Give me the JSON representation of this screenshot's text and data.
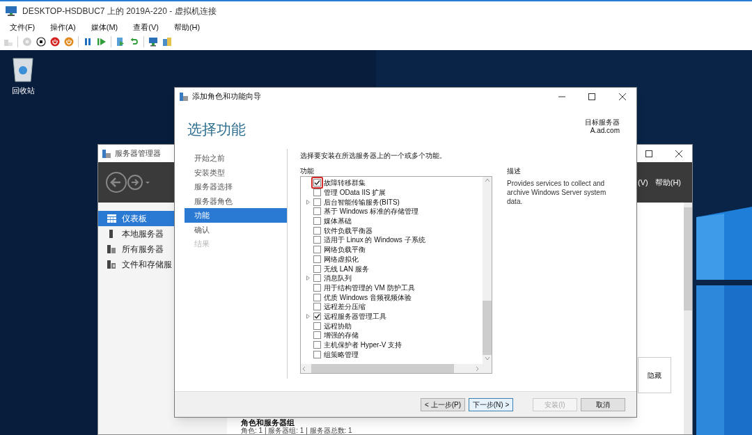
{
  "host_window": {
    "title": "DESKTOP-HSDBUC7 上的 2019A-220 - 虚拟机连接",
    "menu": [
      "文件(F)",
      "操作(A)",
      "媒体(M)",
      "查看(V)",
      "帮助(H)"
    ],
    "toolbar": [
      {
        "kind": "box",
        "disabled": true
      },
      {
        "kind": "sep"
      },
      {
        "kind": "disc",
        "disabled": true
      },
      {
        "kind": "stop",
        "disabled": false
      },
      {
        "kind": "power",
        "disabled": false
      },
      {
        "kind": "reset",
        "disabled": false
      },
      {
        "kind": "sep"
      },
      {
        "kind": "pause",
        "disabled": false
      },
      {
        "kind": "play",
        "disabled": false
      },
      {
        "kind": "sep"
      },
      {
        "kind": "document",
        "disabled": false
      },
      {
        "kind": "undo",
        "disabled": false
      },
      {
        "kind": "sep"
      },
      {
        "kind": "monitor",
        "disabled": false
      },
      {
        "kind": "files",
        "disabled": false
      }
    ]
  },
  "desktop": {
    "icons": [
      {
        "label": "回收站"
      }
    ]
  },
  "server_manager": {
    "title": "服务器管理器",
    "menu": [
      "(V)",
      "帮助(H)"
    ],
    "sidebar": [
      {
        "label": "仪表板",
        "kind": "dashboard",
        "selected": true
      },
      {
        "label": "本地服务器",
        "kind": "server",
        "selected": false
      },
      {
        "label": "所有服务器",
        "kind": "servers",
        "selected": false
      },
      {
        "label": "文件和存储服",
        "kind": "storage",
        "selected": false
      }
    ],
    "hide_button": "隐藏",
    "section_title": "角色和服务器组",
    "section_summary": "角色: 1 | 服务器组: 1 | 服务器总数: 1"
  },
  "wizard": {
    "title": "添加角色和功能向导",
    "heading": "选择功能",
    "target_label": "目标服务器",
    "target_server": "A.ad.com",
    "steps": [
      {
        "label": "开始之前",
        "selected": false,
        "disabled": false
      },
      {
        "label": "安装类型",
        "selected": false,
        "disabled": false
      },
      {
        "label": "服务器选择",
        "selected": false,
        "disabled": false
      },
      {
        "label": "服务器角色",
        "selected": false,
        "disabled": false
      },
      {
        "label": "功能",
        "selected": true,
        "disabled": false
      },
      {
        "label": "确认",
        "selected": false,
        "disabled": false
      },
      {
        "label": "结果",
        "selected": false,
        "disabled": true
      }
    ],
    "instruction": "选择要安装在所选服务器上的一个或多个功能。",
    "features_label": "功能",
    "features": [
      {
        "label": "故障转移群集",
        "checked": true,
        "expandable": false,
        "highlighted": true
      },
      {
        "label": "管理 OData IIS 扩展",
        "checked": false,
        "expandable": false,
        "highlighted": false
      },
      {
        "label": "后台智能传输服务(BITS)",
        "checked": false,
        "expandable": true,
        "highlighted": false
      },
      {
        "label": "基于 Windows 标准的存储管理",
        "checked": false,
        "expandable": false,
        "highlighted": false
      },
      {
        "label": "媒体基础",
        "checked": false,
        "expandable": false,
        "highlighted": false
      },
      {
        "label": "软件负载平衡器",
        "checked": false,
        "expandable": false,
        "highlighted": false
      },
      {
        "label": "适用于 Linux 的 Windows 子系统",
        "checked": false,
        "expandable": false,
        "highlighted": false
      },
      {
        "label": "网络负载平衡",
        "checked": false,
        "expandable": false,
        "highlighted": false
      },
      {
        "label": "网络虚拟化",
        "checked": false,
        "expandable": false,
        "highlighted": false
      },
      {
        "label": "无线 LAN 服务",
        "checked": false,
        "expandable": false,
        "highlighted": false
      },
      {
        "label": "消息队列",
        "checked": false,
        "expandable": true,
        "highlighted": false
      },
      {
        "label": "用于结构管理的 VM 防护工具",
        "checked": false,
        "expandable": false,
        "highlighted": false
      },
      {
        "label": "优质 Windows 音频视频体验",
        "checked": false,
        "expandable": false,
        "highlighted": false
      },
      {
        "label": "远程差分压缩",
        "checked": false,
        "expandable": false,
        "highlighted": false
      },
      {
        "label": "远程服务器管理工具",
        "checked": true,
        "expandable": true,
        "highlighted": false
      },
      {
        "label": "远程协助",
        "checked": false,
        "expandable": false,
        "highlighted": false
      },
      {
        "label": "增强的存储",
        "checked": false,
        "expandable": false,
        "highlighted": false
      },
      {
        "label": "主机保护者 Hyper-V 支持",
        "checked": false,
        "expandable": false,
        "highlighted": false
      },
      {
        "label": "组策略管理",
        "checked": false,
        "expandable": false,
        "highlighted": false
      }
    ],
    "description_label": "描述",
    "description": "Provides services to collect and archive Windows Server system data.",
    "buttons": [
      {
        "label": "< 上一步(P)",
        "disabled": false,
        "default": false
      },
      {
        "label": "下一步(N) >",
        "disabled": false,
        "default": true
      },
      {
        "label": "安装(I)",
        "disabled": true,
        "default": false
      },
      {
        "label": "取消",
        "disabled": false,
        "default": false
      }
    ]
  }
}
